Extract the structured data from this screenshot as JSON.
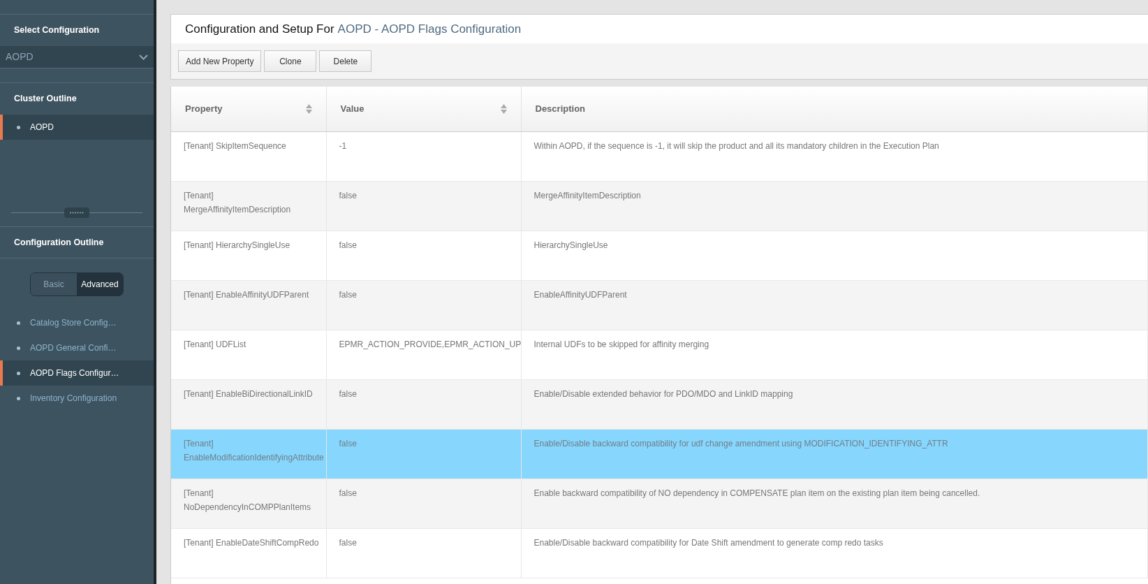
{
  "sidebar": {
    "select_configuration": {
      "title": "Select Configuration",
      "value": "AOPD"
    },
    "cluster_outline": {
      "title": "Cluster Outline",
      "items": [
        {
          "label": "AOPD",
          "selected": true
        }
      ]
    },
    "configuration_outline": {
      "title": "Configuration Outline",
      "modes": [
        {
          "label": "Basic",
          "selected": false
        },
        {
          "label": "Advanced",
          "selected": true
        }
      ],
      "items": [
        {
          "label": "Catalog Store Config…",
          "selected": false
        },
        {
          "label": "AOPD General Confi…",
          "selected": false
        },
        {
          "label": "AOPD Flags Configur…",
          "selected": true
        },
        {
          "label": "Inventory Configuration",
          "selected": false
        }
      ]
    }
  },
  "header": {
    "title": "Configuration and Setup For",
    "title_link": "AOPD - AOPD Flags Configuration"
  },
  "toolbar": [
    "Add New Property",
    "Clone",
    "Delete"
  ],
  "table": {
    "columns": [
      {
        "label": "Property",
        "sortable": true
      },
      {
        "label": "Value",
        "sortable": true
      },
      {
        "label": "Description",
        "sortable": false
      }
    ],
    "rows": [
      {
        "property": "[Tenant] SkipItemSequence",
        "value": "-1",
        "description": "Within AOPD, if the sequence is -1, it will skip the product and all its mandatory children in the Execution Plan",
        "selected": false
      },
      {
        "property": "[Tenant] MergeAffinityItemDescription",
        "value": "false",
        "description": "MergeAffinityItemDescription",
        "selected": false
      },
      {
        "property": "[Tenant] HierarchySingleUse",
        "value": "false",
        "description": "HierarchySingleUse",
        "selected": false
      },
      {
        "property": "[Tenant] EnableAffinityUDFParent",
        "value": "false",
        "description": "EnableAffinityUDFParent",
        "selected": false
      },
      {
        "property": "[Tenant] UDFList",
        "value": "EPMR_ACTION_PROVIDE,EPMR_ACTION_UP",
        "description": "Internal UDFs to be skipped for affinity merging",
        "selected": false
      },
      {
        "property": "[Tenant] EnableBiDirectionalLinkID",
        "value": "false",
        "description": "Enable/Disable extended behavior for PDO/MDO and LinkID mapping",
        "selected": false
      },
      {
        "property": "[Tenant] EnableModificationIdentifyingAttribute",
        "value": "false",
        "description": "Enable/Disable backward compatibility for udf change amendment using MODIFICATION_IDENTIFYING_ATTR",
        "selected": true
      },
      {
        "property": "[Tenant] NoDependencyInCOMPPlanItems",
        "value": "false",
        "description": "Enable backward compatibility of NO dependency in COMPENSATE plan item on the existing plan item being cancelled.",
        "selected": false
      },
      {
        "property": "[Tenant] EnableDateShiftCompRedo",
        "value": "false",
        "description": "Enable/Disable backward compatibility for Date Shift amendment to generate comp redo tasks",
        "selected": false
      }
    ]
  }
}
